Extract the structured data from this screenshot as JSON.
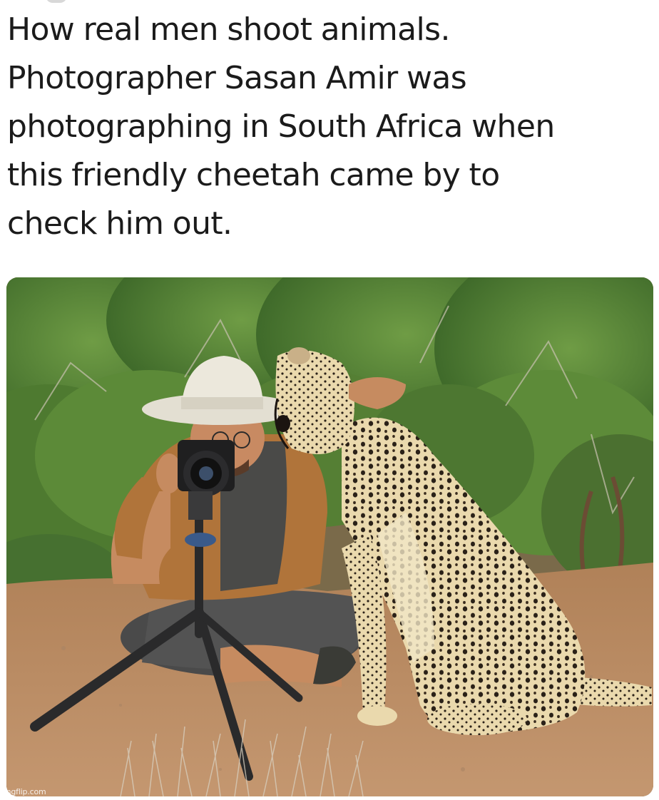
{
  "post": {
    "caption_lines": [
      "How real men shoot animals.",
      "Photographer Sasan Amir was",
      "photographing in South Africa when",
      "this friendly cheetah came by to",
      "check him out."
    ],
    "image_alt": "",
    "watermark": "imgflip.com"
  },
  "colors": {
    "text": "#1b1b1b",
    "background": "#ffffff",
    "ground": "#b98f6a",
    "foliage": "#5f8f3a",
    "cheetah_fur": "#e6d4a6",
    "cheetah_spot": "#2a2118",
    "shirt": "#b0743a",
    "hat": "#e8e4d8"
  }
}
